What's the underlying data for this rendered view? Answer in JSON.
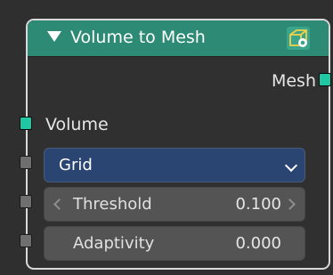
{
  "node": {
    "title": "Volume to Mesh",
    "header_color": "#2d8a74",
    "header_icon": "mesh-volume-icon",
    "outputs": [
      {
        "label": "Mesh",
        "socket_color": "#1fc7a2"
      }
    ],
    "inputs": [
      {
        "label": "Volume",
        "socket_color": "#1fc7a2"
      }
    ],
    "resolution_mode": {
      "value": "Grid"
    },
    "fields": [
      {
        "label": "Threshold",
        "value": "0.100"
      },
      {
        "label": "Adaptivity",
        "value": "0.000"
      }
    ]
  }
}
